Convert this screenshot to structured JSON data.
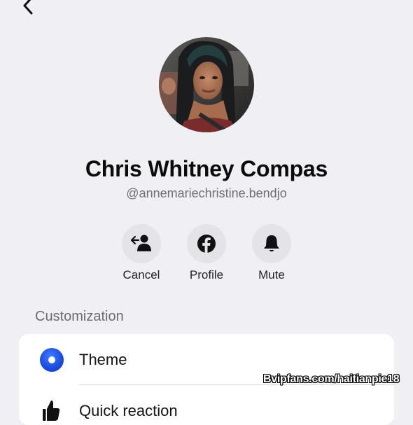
{
  "profile": {
    "name": "Chris Whitney Compas",
    "handle": "@annemariechristine.bendjo"
  },
  "actions": [
    {
      "label": "Cancel",
      "icon": "cancel-request-icon"
    },
    {
      "label": "Profile",
      "icon": "facebook-icon"
    },
    {
      "label": "Mute",
      "icon": "bell-icon"
    }
  ],
  "customization": {
    "title": "Customization",
    "items": [
      {
        "label": "Theme",
        "icon": "theme-icon"
      },
      {
        "label": "Quick reaction",
        "icon": "quick-reaction-icon"
      }
    ]
  },
  "watermark": "Bvipfans.com/haitianpie18",
  "colors": {
    "background": "#f0f0f4",
    "card": "#ffffff",
    "action_circle": "#e3e3e8",
    "theme_blue": "#1d4fe0"
  }
}
